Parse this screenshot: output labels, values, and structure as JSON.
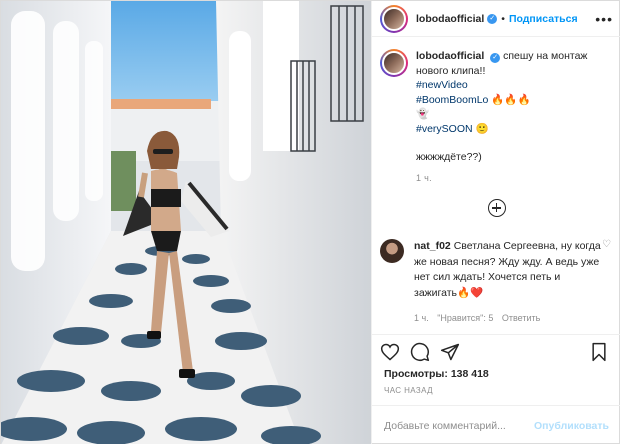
{
  "post": {
    "username": "lobodaofficial",
    "follow_label": "Подписаться",
    "separator": "•"
  },
  "caption": {
    "username": "lobodaofficial",
    "text": "спешу на монтаж нового клипа!!",
    "tags": [
      "#newVideo",
      "#BoomBoomLo 🔥🔥🔥"
    ],
    "ghost": "👻",
    "tag_soon": "#verySOON 🙂",
    "line_wait": "жжжждёте??)",
    "time": "1 ч."
  },
  "reply": {
    "username": "nat_f02",
    "text": "Светлана Сергеевна, ну когда же новая песня? Жду жду. А ведь уже нет сил ждать! Хочется петь и зажигать🔥❤️",
    "time": "1 ч.",
    "likes": "\"Нравится\": 5",
    "reply_label": "Ответить"
  },
  "stats": {
    "views_label": "Просмотры:",
    "views_value": "138 418",
    "ago": "ЧАС НАЗАД"
  },
  "comment_box": {
    "placeholder": "Добавьте комментарий...",
    "publish_label": "Опубликовать"
  },
  "icons": {
    "more": "more-options-icon",
    "like": "heart-icon",
    "comment": "comment-icon",
    "share": "share-icon",
    "save": "bookmark-icon",
    "load_more": "plus-circle-icon",
    "verified": "verified-badge-icon"
  },
  "colors": {
    "accent": "#0095f6",
    "hashtag": "#00376b",
    "publish_disabled": "#b2dffc",
    "muted": "#8e8e8e"
  }
}
